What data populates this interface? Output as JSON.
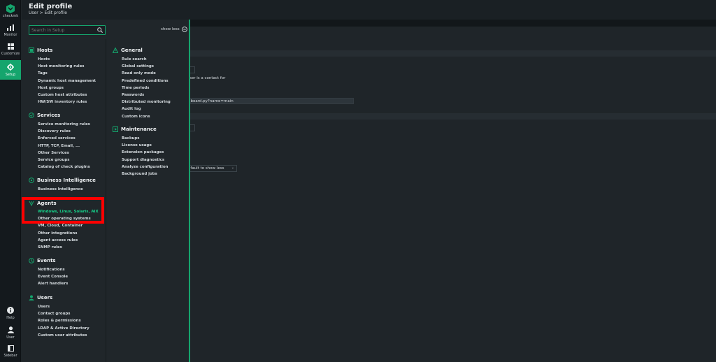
{
  "rail": {
    "logo_text": "checkmk",
    "items": [
      {
        "label": "Monitor"
      },
      {
        "label": "Customize"
      },
      {
        "label": "Setup"
      }
    ],
    "bottom_items": [
      {
        "label": "Help"
      },
      {
        "label": "User"
      },
      {
        "label": "Sidebar"
      }
    ]
  },
  "header": {
    "title": "Edit profile",
    "breadcrumb": "User > Edit profile"
  },
  "background": {
    "contact_text": "ser is a contact for",
    "url_value": "hboard.py?name=main",
    "select_value": "efault to show less"
  },
  "popup": {
    "search_placeholder": "Search in Setup",
    "show_less": "show less",
    "topics": {
      "hosts": {
        "title": "Hosts",
        "items": [
          "Hosts",
          "Host monitoring rules",
          "Tags",
          "Dynamic host management",
          "Host groups",
          "Custom host attributes",
          "HW/SW inventory rules"
        ]
      },
      "services": {
        "title": "Services",
        "items": [
          "Service monitoring rules",
          "Discovery rules",
          "Enforced services",
          "HTTP, TCP, Email, ...",
          "Other Services",
          "Service groups",
          "Catalog of check plugins"
        ]
      },
      "bi": {
        "title": "Business Intelligence",
        "items": [
          "Business Intelligence"
        ]
      },
      "agents": {
        "title": "Agents",
        "items": [
          "Windows, Linux, Solaris, AIX",
          "Other operating systems",
          "VM, Cloud, Container",
          "Other integrations",
          "Agent access rules",
          "SNMP rules"
        ]
      },
      "events": {
        "title": "Events",
        "items": [
          "Notifications",
          "Event Console",
          "Alert handlers"
        ]
      },
      "users": {
        "title": "Users",
        "items": [
          "Users",
          "Contact groups",
          "Roles & permissions",
          "LDAP & Active Directory",
          "Custom user attributes"
        ]
      },
      "general": {
        "title": "General",
        "items": [
          "Rule search",
          "Global settings",
          "Read only mode",
          "Predefined conditions",
          "Time periods",
          "Passwords",
          "Distributed monitoring",
          "Audit log",
          "Custom icons"
        ]
      },
      "maintenance": {
        "title": "Maintenance",
        "items": [
          "Backups",
          "License usage",
          "Extension packages",
          "Support diagnostics",
          "Analyze configuration",
          "Background jobs"
        ]
      }
    }
  },
  "colors": {
    "accent": "#15a56d",
    "highlight_text": "#15d38b",
    "annotation": "#ff0000"
  }
}
